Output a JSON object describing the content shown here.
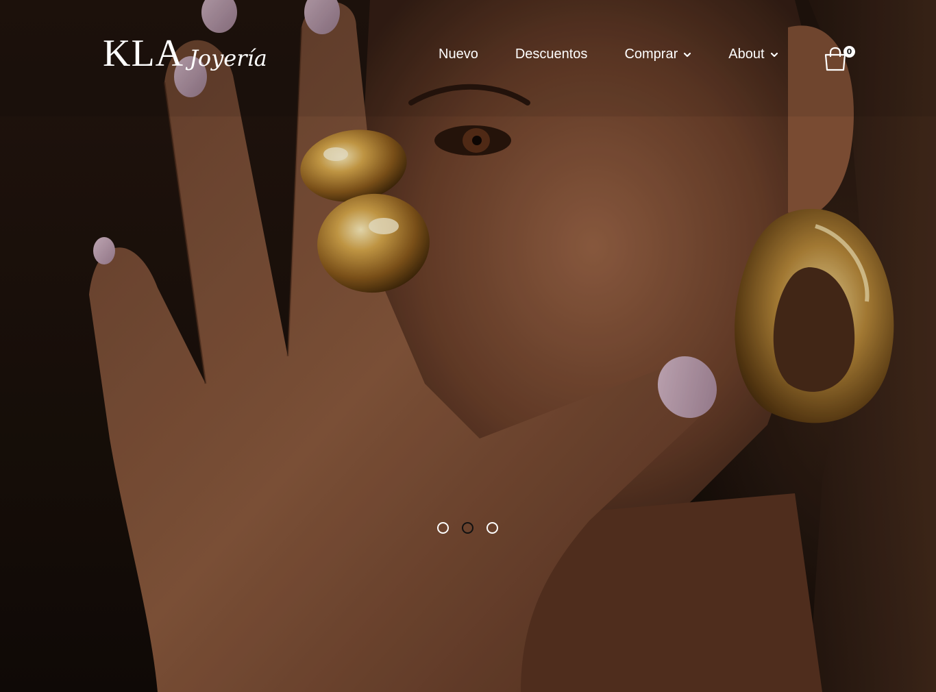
{
  "brand": {
    "name": "KLA",
    "script": "Joyería"
  },
  "nav": {
    "items": [
      {
        "label": "Nuevo",
        "has_dropdown": false
      },
      {
        "label": "Descuentos",
        "has_dropdown": false
      },
      {
        "label": "Comprar",
        "has_dropdown": true
      },
      {
        "label": "About",
        "has_dropdown": true
      }
    ]
  },
  "cart": {
    "icon": "shopping-bag-icon",
    "count": "0"
  },
  "hero": {
    "image_alt": "Model wearing gold rings and earring",
    "slides_total": 3,
    "active_slide": 2
  },
  "colors": {
    "text": "#ffffff",
    "gold": "#c9993f",
    "nail": "#c6a5b8",
    "background": "#1a0f0a"
  }
}
